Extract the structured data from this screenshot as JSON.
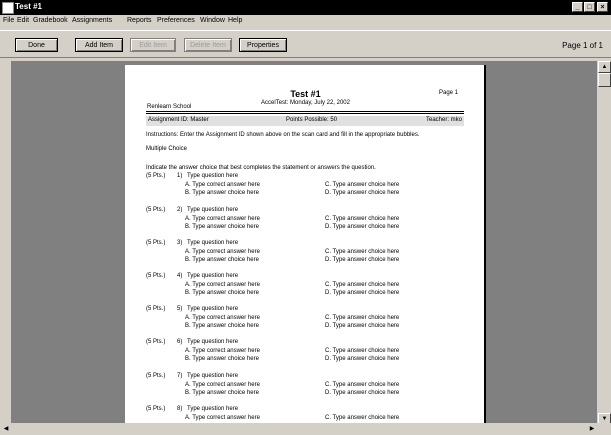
{
  "window": {
    "title": "Test #1"
  },
  "menu": [
    "File",
    "Edit",
    "Gradebook",
    "Assignments",
    "Reports",
    "Preferences",
    "Window",
    "Help"
  ],
  "toolbar": {
    "done": "Done",
    "add_item": "Add Item",
    "edit_item": "Edit Item",
    "delete_item": "Delete Item",
    "properties": "Properties",
    "page_info": "Page 1 of 1"
  },
  "paper": {
    "title": "Test #1",
    "page": "Page 1",
    "subtitle": "AccelTest: Monday, July 22, 2002",
    "school": "Renlearn School",
    "assignment": "Assignment ID: Master",
    "points": "Points Possible: 50",
    "teacher": "Teacher: mko",
    "instructions": "Instructions: Enter the Assignment ID shown above on the scan card and fill in the appropriate bubbles.",
    "section": "Multiple Choice",
    "indication": "Indicate the answer choice that best completes the statement or answers the question.",
    "questions": [
      {
        "pts": "(5 Pts.)",
        "num": "1)",
        "text": "Type question here",
        "a": "A. Type correct answer here",
        "b": "B. Type answer choice here",
        "c": "C. Type answer choice here",
        "d": "D. Type answer choice here"
      },
      {
        "pts": "(5 Pts.)",
        "num": "2)",
        "text": "Type question here",
        "a": "A. Type correct answer here",
        "b": "B. Type answer choice here",
        "c": "C. Type answer choice here",
        "d": "D. Type answer choice here"
      },
      {
        "pts": "(5 Pts.)",
        "num": "3)",
        "text": "Type question here",
        "a": "A. Type correct answer here",
        "b": "B. Type answer choice here",
        "c": "C. Type answer choice here",
        "d": "D. Type answer choice here"
      },
      {
        "pts": "(5 Pts.)",
        "num": "4)",
        "text": "Type question here",
        "a": "A. Type correct answer here",
        "b": "B. Type answer choice here",
        "c": "C. Type answer choice here",
        "d": "D. Type answer choice here"
      },
      {
        "pts": "(5 Pts.)",
        "num": "5)",
        "text": "Type question here",
        "a": "A. Type correct answer here",
        "b": "B. Type answer choice here",
        "c": "C. Type answer choice here",
        "d": "D. Type answer choice here"
      },
      {
        "pts": "(5 Pts.)",
        "num": "6)",
        "text": "Type question here",
        "a": "A. Type correct answer here",
        "b": "B. Type answer choice here",
        "c": "C. Type answer choice here",
        "d": "D. Type answer choice here"
      },
      {
        "pts": "(5 Pts.)",
        "num": "7)",
        "text": "Type question here",
        "a": "A. Type correct answer here",
        "b": "B. Type answer choice here",
        "c": "C. Type answer choice here",
        "d": "D. Type answer choice here"
      },
      {
        "pts": "(5 Pts.)",
        "num": "8)",
        "text": "Type question here",
        "a": "A. Type correct answer here",
        "c": "C. Type answer choice here"
      }
    ]
  }
}
